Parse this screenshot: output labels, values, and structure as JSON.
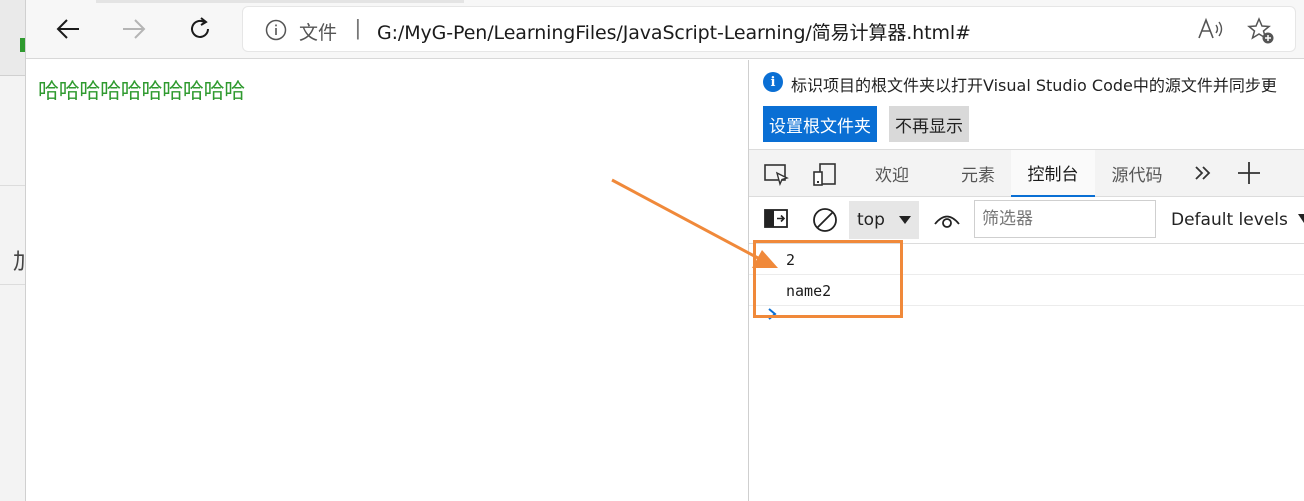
{
  "toolbar": {
    "address_scheme": "文件",
    "address_separator": "|",
    "address_url": "G:/MyG-Pen/LearningFiles/JavaScript-Learning/简易计算器.html#"
  },
  "page": {
    "text": "哈哈哈哈哈哈哈哈哈哈"
  },
  "behind_window": {
    "partial_char": "加"
  },
  "devtools": {
    "info_message": "标识项目的根文件夹以打开Visual Studio Code中的源文件并同步更",
    "set_root_button": "设置根文件夹",
    "dont_show_button": "不再显示",
    "tabs": [
      {
        "label": "欢迎",
        "active": false
      },
      {
        "label": "元素",
        "active": false
      },
      {
        "label": "控制台",
        "active": true
      },
      {
        "label": "源代码",
        "active": false
      }
    ],
    "console_toolbar": {
      "context": "top",
      "filter_placeholder": "筛选器",
      "levels": "Default levels"
    },
    "console_lines": [
      "2",
      "name2"
    ]
  },
  "colors": {
    "accent": "#0a6fd4",
    "page_text": "#2f9a2f",
    "annotation": "#f0893a"
  }
}
